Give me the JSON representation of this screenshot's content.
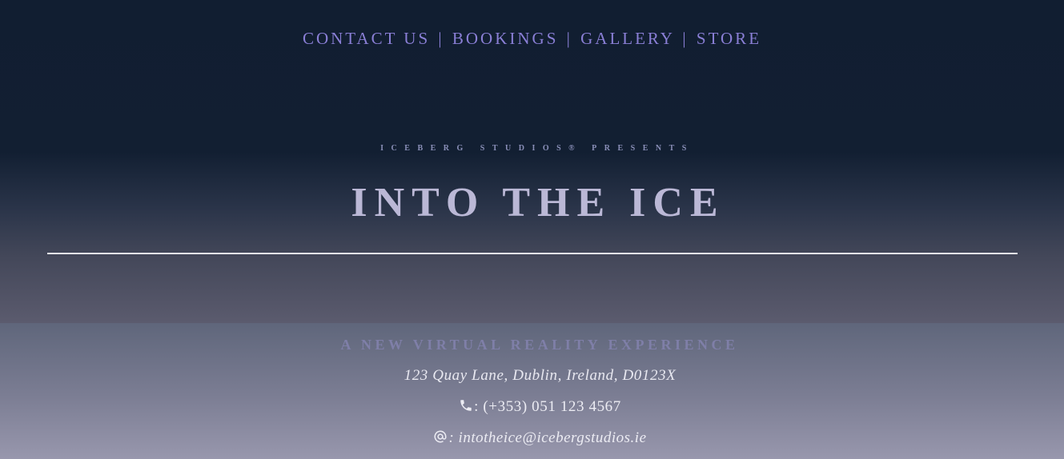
{
  "nav": {
    "items": [
      {
        "label": "CONTACT US"
      },
      {
        "label": "BOOKINGS"
      },
      {
        "label": "GALLERY"
      },
      {
        "label": "STORE"
      }
    ],
    "separator": "|"
  },
  "hero": {
    "presents": "ICEBERG STUDIOS® PRESENTS",
    "title": "INTO THE ICE"
  },
  "footer": {
    "tagline": "A NEW VIRTUAL REALITY EXPERIENCE",
    "address": "123 Quay Lane, Dublin, Ireland, D0123X",
    "phone_text": ": (+353) 051 123 4567",
    "email_text": ": intotheice@icebergstudios.ie",
    "phone_icon": "phone-icon",
    "email_icon": "at-sign-icon"
  },
  "colors": {
    "nav": "#8a7fd6",
    "title": "#bbb8d6",
    "tagline": "#7f7fa8",
    "rule": "#e9e9f2"
  }
}
